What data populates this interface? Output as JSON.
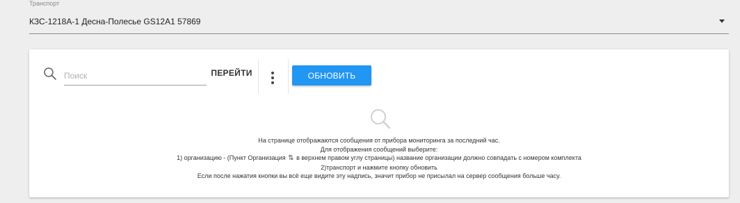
{
  "transport": {
    "label": "Транспорт",
    "value": "КЗС-1218А-1 Десна-Полесье GS12A1 57869"
  },
  "toolbar": {
    "search_placeholder": "Поиск",
    "go_label": "ПЕРЕЙТИ",
    "refresh_label": "ОБНОВИТЬ"
  },
  "accent_color": "#2196f3",
  "icons": {
    "search": "search-icon",
    "more": "more-vert-icon",
    "swap": "swap-vert-icon",
    "dropdown": "arrow-drop-down-icon"
  },
  "empty_state": {
    "line1": "На странице отображаются сообщения от прибора мониторинга за последний час.",
    "line2": "Для отображения сообщений выберите:",
    "line3_before": "1) организацию - (Пункт Организация",
    "line3_icon": "⇅",
    "line3_after": "в верхнем правом углу страницы) название организации должно совпадать с номером комплекта",
    "line4": "2)транспорт и нажмите кнопку обновить",
    "line5": "Если после нажатия кнопки вы всё еще видите эту надпись, значит прибор не присылал на сервер сообщения больше часу."
  }
}
